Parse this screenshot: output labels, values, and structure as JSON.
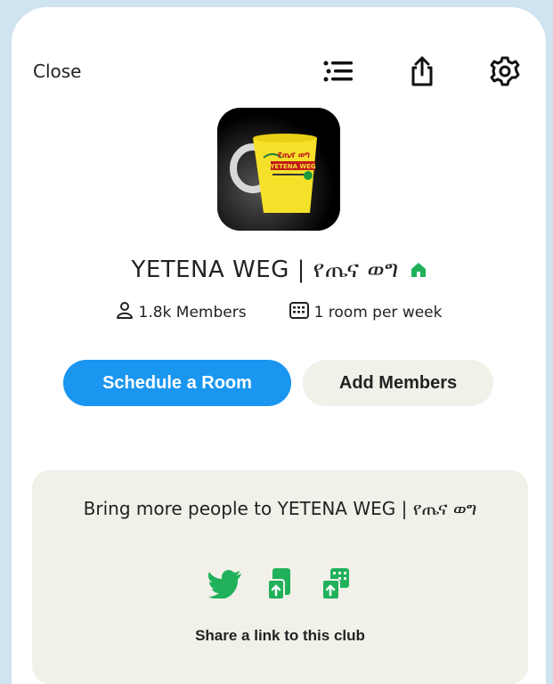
{
  "header": {
    "close_label": "Close",
    "icons": [
      "list-icon",
      "share-icon",
      "settings-icon"
    ]
  },
  "club": {
    "avatar_mug_text_line1": "የጤና ወግ",
    "avatar_mug_text_line2": "YETENA WEG",
    "name": "YETENA WEG | የጤና ወግ",
    "members": "1.8k Members",
    "schedule": "1 room per week",
    "status_color": "#20b15a"
  },
  "actions": {
    "schedule_label": "Schedule a Room",
    "add_members_label": "Add Members"
  },
  "promo": {
    "text": "Bring more people to YETENA WEG | የጤና ወግ",
    "share_icons": [
      "twitter-icon",
      "share-sms-icon",
      "share-copy-icon"
    ],
    "share_link_label": "Share a link to this club"
  },
  "colors": {
    "primary": "#1a96f0",
    "green": "#20b15a",
    "background": "#cfe3f0"
  }
}
